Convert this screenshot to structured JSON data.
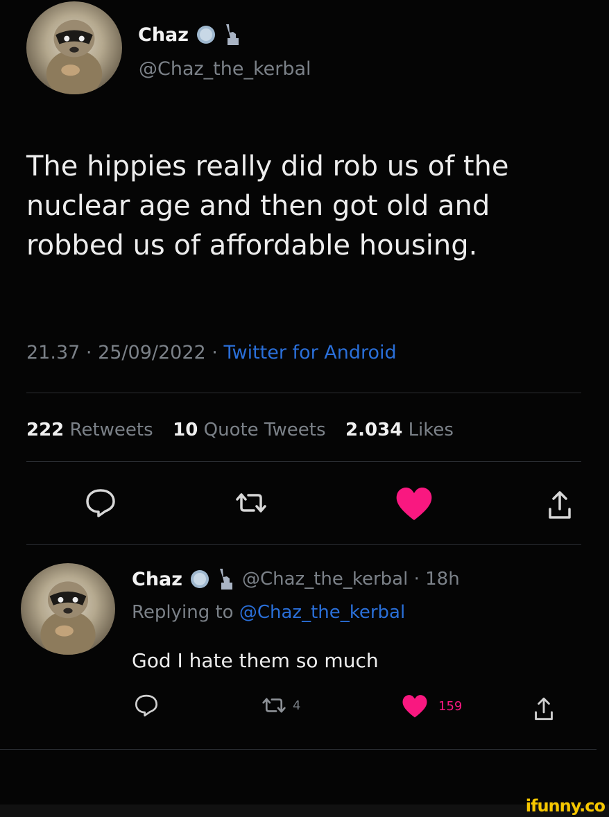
{
  "main_tweet": {
    "display_name": "Chaz",
    "handle": "@Chaz_the_kerbal",
    "text_lines": [
      "The hippies really did rob us of the",
      "nuclear age and then got old and",
      "robbed us of affordable housing."
    ],
    "time": "21.37",
    "date": "25/09/2022",
    "separator": "·",
    "source": "Twitter for Android",
    "stats": {
      "retweets_count": "222",
      "retweets_label": "Retweets",
      "quotes_count": "10",
      "quotes_label": "Quote Tweets",
      "likes_count": "2.034",
      "likes_label": "Likes"
    }
  },
  "reply": {
    "display_name": "Chaz",
    "handle_time": "@Chaz_the_kerbal · 18h",
    "replying_prefix": "Replying to",
    "replying_handle": "@Chaz_the_kerbal",
    "text": "God I hate them so much",
    "retweet_count": "4",
    "like_count": "159"
  },
  "watermark": "ifunny.co",
  "colors": {
    "background": "#050505",
    "like": "#f91880",
    "link": "#2a6fd8",
    "muted": "#7b8188",
    "watermark": "#f6c700"
  },
  "icons": [
    "verified-badge-icon",
    "statue-of-liberty-icon",
    "reply-icon",
    "retweet-icon",
    "heart-icon",
    "share-icon"
  ]
}
